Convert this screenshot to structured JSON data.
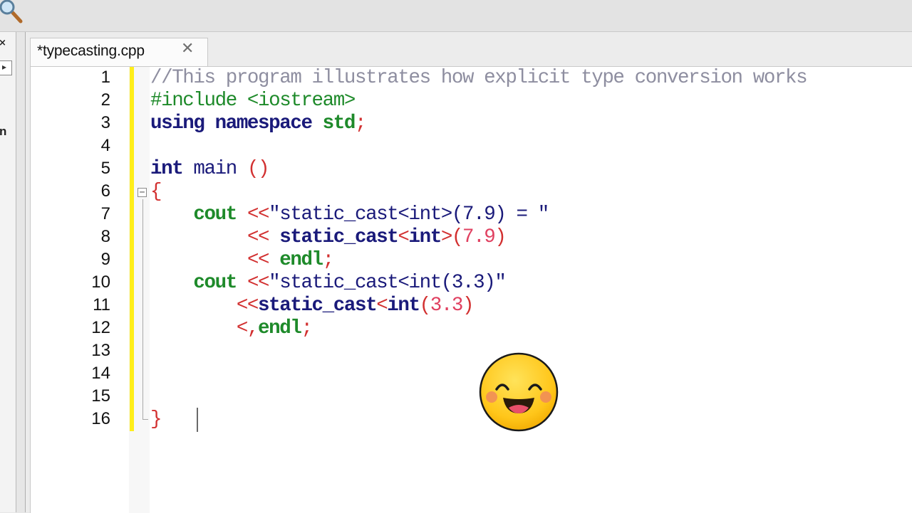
{
  "tab": {
    "title": "*typecasting.cpp",
    "close": "✕"
  },
  "side_panel": {
    "close": "×",
    "button": "▸",
    "partial_text": "n"
  },
  "editor": {
    "line_numbers": [
      "1",
      "2",
      "3",
      "4",
      "5",
      "6",
      "7",
      "8",
      "9",
      "10",
      "11",
      "12",
      "13",
      "14",
      "15",
      "16"
    ],
    "code": {
      "l1": {
        "comment": "//This program illustrates how explicit type conversion works"
      },
      "l2": {
        "directive": "#include",
        "header": " <iostream>"
      },
      "l3": {
        "using": "using",
        "namespace": " namespace",
        "std": " std",
        "semi": ";"
      },
      "l5": {
        "type": "int",
        "name": " main ",
        "parens": "()"
      },
      "l6": {
        "brace": "{"
      },
      "l7": {
        "cout": "    cout ",
        "op": "<<",
        "str": "\"static_cast<int>(7.9) = \""
      },
      "l8": {
        "indent": "         ",
        "op": "<< ",
        "cast": "static_cast",
        "lt": "<",
        "type": "int",
        "gt": ">",
        "lp": "(",
        "num": "7.9",
        "rp": ")"
      },
      "l9": {
        "indent": "         ",
        "op": "<< ",
        "endl": "endl",
        "semi": ";"
      },
      "l10": {
        "cout": "    cout ",
        "op": "<<",
        "str": "\"static_cast<int(3.3)\""
      },
      "l11": {
        "indent": "        ",
        "op": "<<",
        "cast": "static_cast",
        "lt": "<",
        "type": "int",
        "lp": "(",
        "num": "3.3",
        "rp": ")"
      },
      "l12": {
        "indent": "        ",
        "op": "<",
        "comma": ",",
        "endl": "endl",
        "semi": ";"
      },
      "l16": {
        "brace": "}"
      }
    }
  },
  "colors": {
    "keyword": "#1a1a7a",
    "comment": "#8e8ea0",
    "preprocessor": "#1e8a2a",
    "operator": "#d23030",
    "number": "#e04060",
    "change_marker": "#ffee1a"
  },
  "overlay": {
    "icon": "smiley-face-icon"
  }
}
